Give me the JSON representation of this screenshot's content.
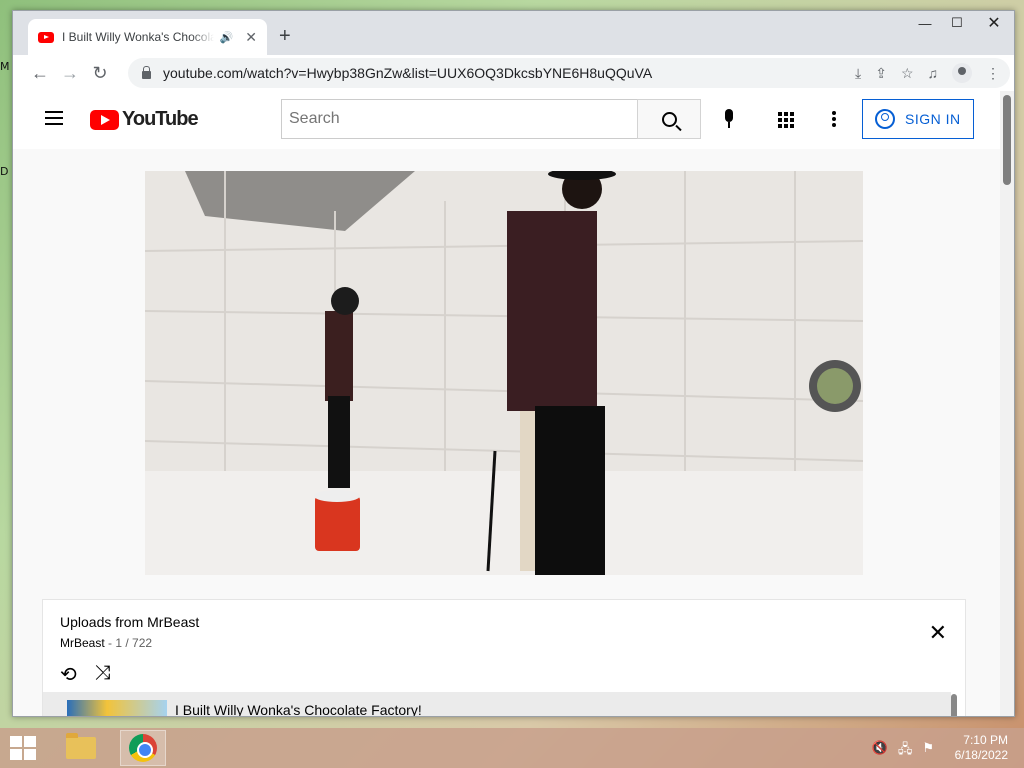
{
  "desktop": {
    "label_m": "M",
    "label_d": "D"
  },
  "browser": {
    "tab": {
      "title": "I Built Willy Wonka's Chocolate Factory!",
      "audio_icon": "🔊",
      "close": "✕"
    },
    "new_tab": "+",
    "window_controls": {
      "minimize": "—",
      "maximize": "☐",
      "close": "✕"
    },
    "nav": {
      "back": "←",
      "forward": "→",
      "reload": "↻"
    },
    "url": "youtube.com/watch?v=Hwybp38GnZw&list=UUX6OQ3DkcsbYNE6H8uQQuVA",
    "omni_icons": {
      "install": "⤓",
      "share": "⇪",
      "bookmark": "☆",
      "media": "♫"
    },
    "menu": "⋮"
  },
  "youtube": {
    "logo_text": "YouTube",
    "search_placeholder": "Search",
    "signin_label": "SIGN IN"
  },
  "playlist": {
    "title": "Uploads from MrBeast",
    "channel": "MrBeast",
    "position": "1 / 722",
    "close": "✕",
    "loop_icon": "⟲",
    "shuffle_icon": "⤨",
    "item_title": "I Built Willy Wonka's Chocolate Factory!"
  },
  "taskbar": {
    "time": "7:10 PM",
    "date": "6/18/2022",
    "tray_volume": "🔇",
    "tray_network": "🖧",
    "tray_flag": "⚑"
  },
  "colors": {
    "yt_red": "#ff0000",
    "signin_blue": "#065fd4"
  }
}
